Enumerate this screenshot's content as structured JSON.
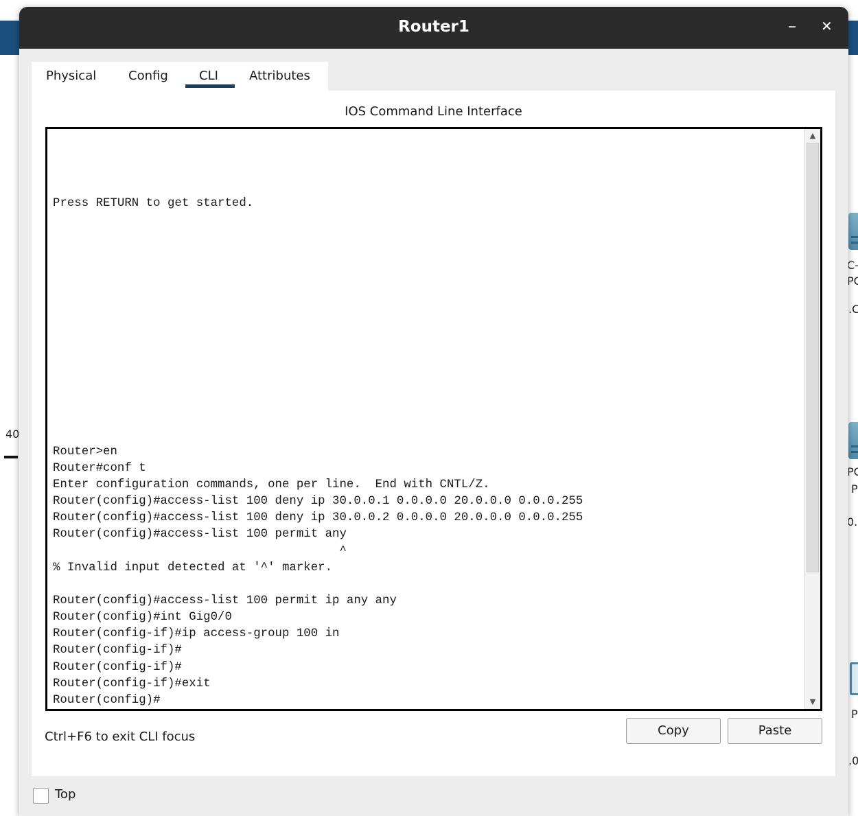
{
  "window": {
    "title": "Router1",
    "minimize_glyph": "–",
    "close_glyph": "✕"
  },
  "tabs": [
    {
      "label": "Physical"
    },
    {
      "label": "Config"
    },
    {
      "label": "CLI",
      "selected": true
    },
    {
      "label": "Attributes"
    }
  ],
  "cli": {
    "heading": "IOS Command Line Interface",
    "lines": [
      "",
      "",
      "",
      "",
      "Press RETURN to get started.",
      "",
      "",
      "",
      "",
      "",
      "",
      "",
      "",
      "",
      "",
      "",
      "",
      "",
      "",
      "Router>en",
      "Router#conf t",
      "Enter configuration commands, one per line.  End with CNTL/Z.",
      "Router(config)#access-list 100 deny ip 30.0.0.1 0.0.0.0 20.0.0.0 0.0.0.255",
      "Router(config)#access-list 100 deny ip 30.0.0.2 0.0.0.0 20.0.0.0 0.0.0.255",
      "Router(config)#access-list 100 permit any",
      "                                        ^",
      "% Invalid input detected at '^' marker.",
      "",
      "Router(config)#access-list 100 permit ip any any",
      "Router(config)#int Gig0/0",
      "Router(config-if)#ip access-group 100 in",
      "Router(config-if)#",
      "Router(config-if)#",
      "Router(config-if)#exit",
      "Router(config)#",
      "Router(config)#"
    ],
    "focus_hint": "Ctrl+F6 to exit CLI focus",
    "copy_label": "Copy",
    "paste_label": "Paste"
  },
  "footer": {
    "top_label": "Top",
    "top_checked": false
  },
  "background": {
    "fragments": [
      "C-",
      "PC",
      ".C",
      "40",
      "PC",
      "P",
      "0.",
      "P",
      ".0"
    ]
  }
}
